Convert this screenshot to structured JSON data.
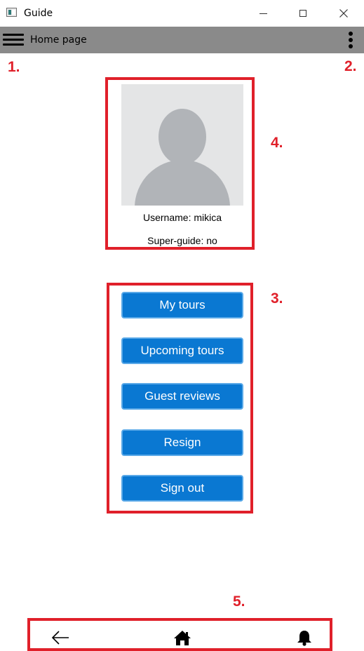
{
  "window": {
    "title": "Guide",
    "icon": "app-window-icon",
    "controls": [
      "minimize-icon",
      "maximize-icon",
      "close-icon"
    ]
  },
  "toolbar": {
    "menu_icon": "hamburger-menu-icon",
    "title": "Home page",
    "more_icon": "kebab-menu-icon",
    "background": "#8a8a8a"
  },
  "profile": {
    "avatar_icon": "user-avatar-icon",
    "username": "Username: mikica",
    "super_guide": "Super-guide: no"
  },
  "menu": {
    "buttons": [
      {
        "label": "My tours"
      },
      {
        "label": "Upcoming tours"
      },
      {
        "label": "Guest reviews"
      },
      {
        "label": "Resign"
      },
      {
        "label": "Sign out"
      }
    ],
    "button_color": "#0a78d2"
  },
  "bottom_nav": {
    "icons": [
      "back-arrow-icon",
      "home-icon",
      "bell-icon"
    ]
  },
  "annotations": {
    "color": "#e0202a",
    "labels": [
      "1.",
      "2.",
      "3.",
      "4.",
      "5."
    ]
  }
}
